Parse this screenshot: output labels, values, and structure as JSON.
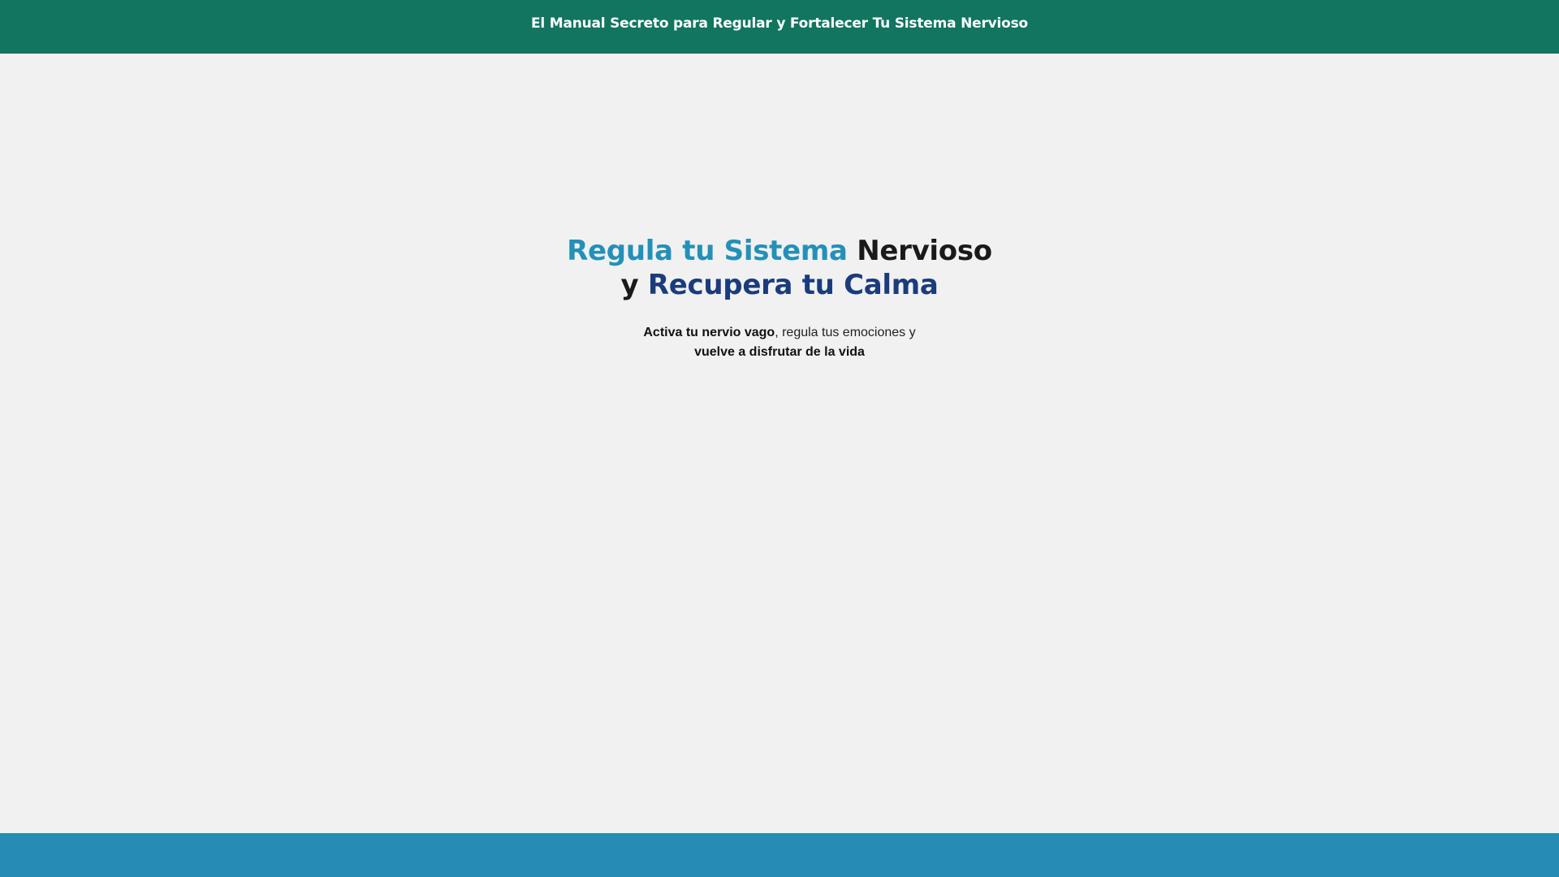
{
  "header": {
    "title": "El Manual Secreto para Regular y Fortalecer Tu Sistema Nervioso"
  },
  "hero": {
    "headline_line1_accent": "Regula tu Sistema",
    "headline_line1_plain": "Nervioso",
    "headline_line2_plain": "y",
    "headline_line2_accent": "Recupera tu Calma",
    "sub_line1_bold": "Activa tu nervio vago",
    "sub_line1_rest": ", regula tus emociones y",
    "sub_line2_bold": "vuelve a disfrutar de la vida"
  },
  "colors": {
    "header_bg": "#117560",
    "accent_light": "#2490b8",
    "accent_dark": "#1a3c7c",
    "page_bg": "#f1f1f1",
    "footer_bg": "#268cb6"
  }
}
